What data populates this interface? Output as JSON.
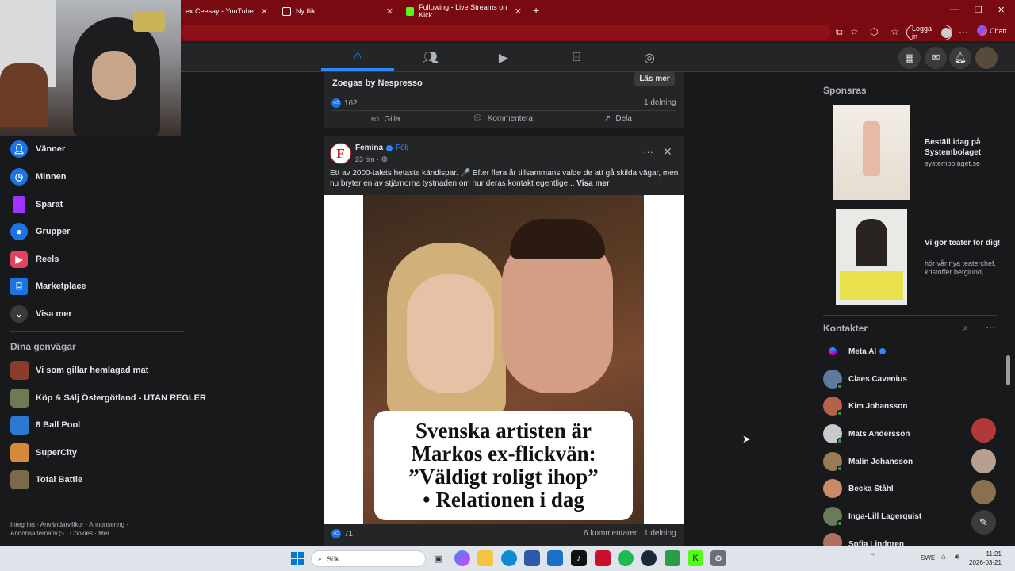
{
  "browser": {
    "tabs": [
      {
        "title": "ex Ceesay - YouTube"
      },
      {
        "title": "Ny flik"
      },
      {
        "title": "Following - Live Streams on Kick"
      }
    ],
    "login_label": "Logga in",
    "chat_label": "Chatt"
  },
  "left_sidebar": {
    "items": [
      {
        "label": "Vänner"
      },
      {
        "label": "Minnen"
      },
      {
        "label": "Sparat"
      },
      {
        "label": "Grupper"
      },
      {
        "label": "Reels"
      },
      {
        "label": "Marketplace"
      },
      {
        "label": "Visa mer"
      }
    ],
    "shortcuts_title": "Dina genvägar",
    "shortcuts": [
      {
        "label": "Vi som gillar hemlagad mat"
      },
      {
        "label": "Köp & Sälj Östergötland - UTAN REGLER"
      },
      {
        "label": "8 Ball Pool"
      },
      {
        "label": "SuperCity"
      },
      {
        "label": "Total Battle"
      }
    ],
    "footer": "Integritet · Användarvillkor · Annonsering · Annonsalternativ ▷ · Cookies · Mer"
  },
  "feed": {
    "post1": {
      "ad_name": "Zoegas by Nespresso",
      "cta": "Läs mer",
      "reactions": "162",
      "shares": "1 delning",
      "like": "Gilla",
      "comment": "Kommentera",
      "share": "Dela"
    },
    "post2": {
      "author": "Femina",
      "follow": "Följ",
      "time": "23 tim ·",
      "text": "Ett av 2000-talets hetaste kändispar. 🎤 Efter flera år tillsammans valde de att gå skilda vägar, men nu bryter en av stjärnorna tystnaden om hur deras kontakt egentlige...",
      "see_more": "Visa mer",
      "headline1": "Svenska artisten är",
      "headline2": "Markos ex-flickvän:",
      "headline3": "”Väldigt roligt ihop”",
      "headline4": "• Relationen i dag",
      "reactions": "71",
      "comments": "6 kommentarer",
      "shares": "1 delning"
    }
  },
  "right_sidebar": {
    "sponsored_title": "Sponsras",
    "ads": [
      {
        "title": "Beställ idag på Systembolaget",
        "domain": "systembolaget.se"
      },
      {
        "title": "Vi gör teater för dig!",
        "domain": "hör vår nya teaterchef, kristoffer berglund,..."
      }
    ],
    "contacts_title": "Kontakter",
    "contacts": [
      {
        "name": "Meta AI"
      },
      {
        "name": "Claes Cavenius"
      },
      {
        "name": "Kim Johansson"
      },
      {
        "name": "Mats Andersson"
      },
      {
        "name": "Malin Johansson"
      },
      {
        "name": "Becka Ståhl"
      },
      {
        "name": "Inga-Lill Lagerquist"
      },
      {
        "name": "Sofia Lindgren"
      }
    ]
  },
  "taskbar": {
    "search_placeholder": "Sök",
    "lang": "SWE",
    "time": "11:21",
    "date": "2026-03-21"
  }
}
